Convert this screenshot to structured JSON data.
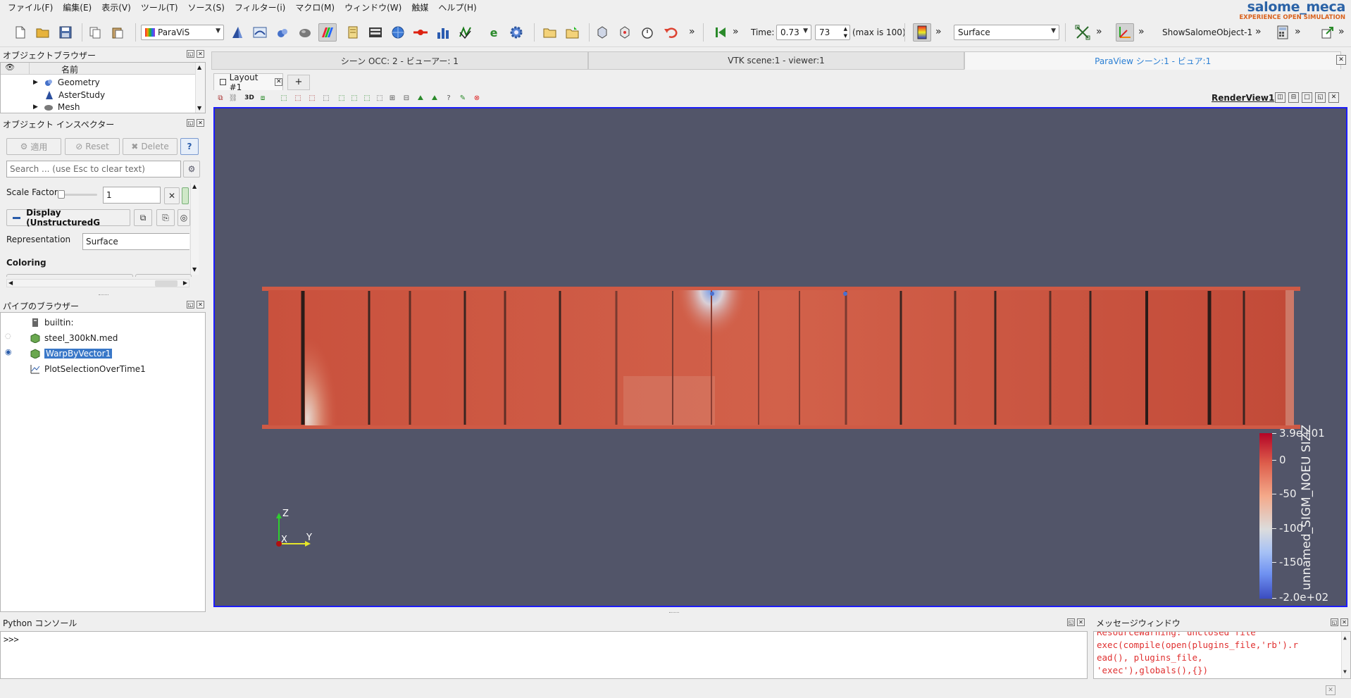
{
  "menu": [
    "ファイル(F)",
    "編集(E)",
    "表示(V)",
    "ツール(T)",
    "ソース(S)",
    "フィルター(i)",
    "マクロ(M)",
    "ウィンドウ(W)",
    "触媒",
    "ヘルプ(H)"
  ],
  "logo": {
    "title": "salome_meca",
    "subtitle": "EXPERIENCE OPEN SIMULATION"
  },
  "toolbar": {
    "module": "ParaViS",
    "time_label": "Time:",
    "time_value": "0.73",
    "timestep": "73",
    "max_label": "(max is 100)",
    "representation": "Surface",
    "object_label": "ShowSalomeObject-1"
  },
  "object_browser": {
    "title": "オブジェクトブラウザー",
    "column": "名前",
    "items": [
      "Geometry",
      "AsterStudy",
      "Mesh"
    ]
  },
  "inspector": {
    "title": "オブジェクト インスペクター",
    "apply": "適用",
    "reset": "Reset",
    "delete": "Delete",
    "help": "?",
    "search_placeholder": "Search ... (use Esc to clear text)",
    "scale_factor_label": "Scale Factor",
    "scale_factor_value": "1",
    "display_label": "Display (UnstructuredG",
    "representation_label": "Representation",
    "representation_value": "Surface",
    "coloring_label": "Coloring"
  },
  "pipeline": {
    "title": "パイプのブラウザー",
    "items": [
      "builtin:",
      "steel_300kN.med",
      "WarpByVector1",
      "PlotSelectionOverTime1"
    ]
  },
  "view_tabs": [
    "シーン OCC: 2 - ビューアー: 1",
    "VTK scene:1 - viewer:1",
    "ParaView シーン:1 - ビュア:1"
  ],
  "layout_tab": "Layout #1",
  "add_tab": "+",
  "render_view_label": "RenderView1",
  "colorbar": {
    "title": "unnamed_SIGM_NOEU SIZZ",
    "labels": [
      "3.9e+01",
      "0",
      "-50",
      "-100",
      "-150",
      "-2.0e+02"
    ],
    "range": [
      -200,
      39
    ]
  },
  "axes": {
    "z": "Z",
    "x": "X",
    "y": "Y"
  },
  "python_console": {
    "title": "Python コンソール",
    "prompt": ">>>"
  },
  "message_window": {
    "title": "メッセージウィンドウ",
    "lines": [
      "ResourceWarning: unclosed file",
      "exec(compile(open(plugins_file,'rb').r",
      "ead(), plugins_file,",
      "'exec'),globals(),{})"
    ]
  }
}
